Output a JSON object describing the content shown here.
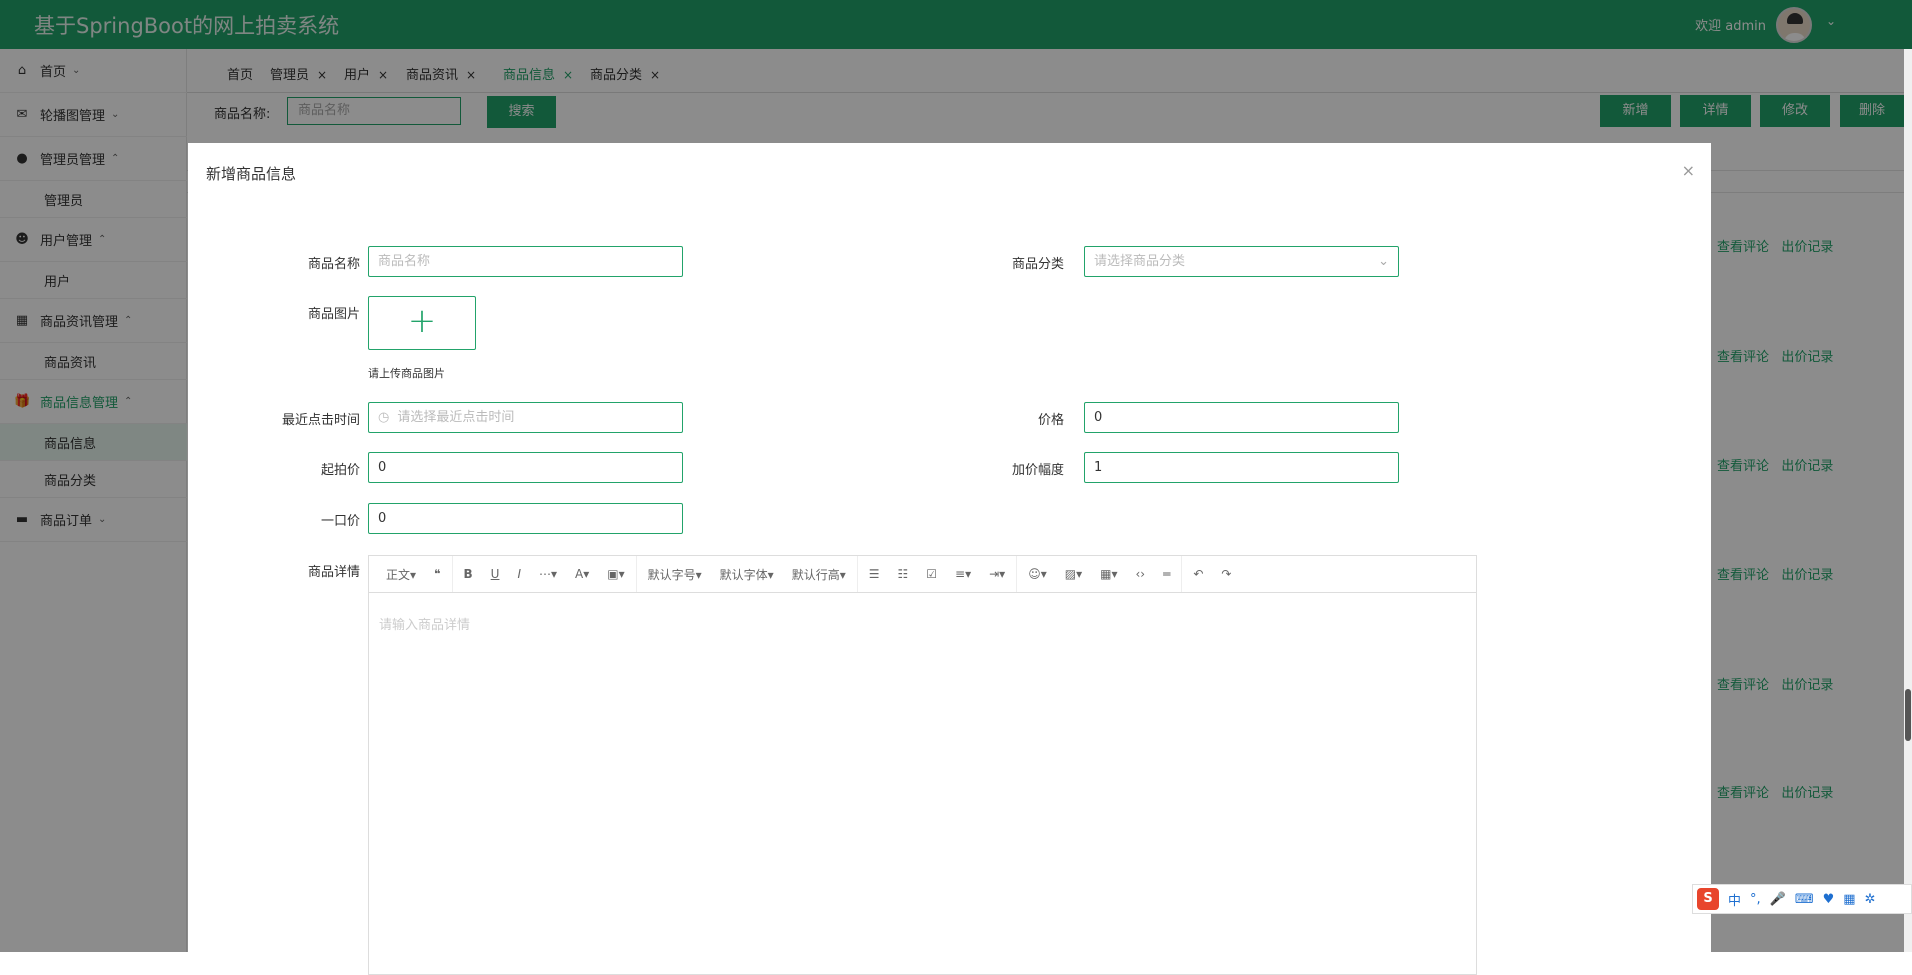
{
  "header": {
    "title": "基于SpringBoot的网上拍卖系统",
    "welcome": "欢迎 admin"
  },
  "sidebar": {
    "items": [
      {
        "label": "首页",
        "icon": "home-icon"
      },
      {
        "label": "轮播图管理",
        "icon": "mail-icon"
      },
      {
        "label": "管理员管理",
        "icon": "circle-icon"
      },
      {
        "label": "管理员"
      },
      {
        "label": "用户管理",
        "icon": "user-icon"
      },
      {
        "label": "用户"
      },
      {
        "label": "商品资讯管理",
        "icon": "building-icon"
      },
      {
        "label": "商品资讯"
      },
      {
        "label": "商品信息管理",
        "icon": "gift-icon"
      },
      {
        "label": "商品信息"
      },
      {
        "label": "商品分类"
      },
      {
        "label": "商品订单",
        "icon": "folder-icon"
      }
    ]
  },
  "tabs": [
    {
      "label": "首页"
    },
    {
      "label": "管理员"
    },
    {
      "label": "用户"
    },
    {
      "label": "商品资讯"
    },
    {
      "label": "商品信息"
    },
    {
      "label": "商品分类"
    }
  ],
  "tab_close": "×",
  "search": {
    "label": "商品名称:",
    "placeholder": "商品名称",
    "button": "搜索"
  },
  "actions": {
    "add": "新增",
    "detail": "详情",
    "edit": "修改",
    "delete": "删除"
  },
  "row_actions": {
    "comments": "查看评论",
    "bids": "出价记录"
  },
  "modal": {
    "title": "新增商品信息",
    "close": "×",
    "fields": {
      "name": {
        "label": "商品名称",
        "placeholder": "商品名称"
      },
      "category": {
        "label": "商品分类",
        "placeholder": "请选择商品分类"
      },
      "image": {
        "label": "商品图片",
        "hint": "请上传商品图片"
      },
      "click_time": {
        "label": "最近点击时间",
        "placeholder": "请选择最近点击时间"
      },
      "price": {
        "label": "价格",
        "value": "0"
      },
      "start_price": {
        "label": "起拍价",
        "value": "0"
      },
      "increment": {
        "label": "加价幅度",
        "value": "1"
      },
      "buy_now": {
        "label": "一口价",
        "value": "0"
      },
      "detail": {
        "label": "商品详情",
        "placeholder": "请输入商品详情"
      }
    },
    "editor_toolbar": [
      "正文▾",
      "❝",
      "B",
      "U",
      "I",
      "⋯▾",
      "A▾",
      "▣▾",
      "默认字号▾",
      "默认字体▾",
      "默认行高▾",
      "☰",
      "☷",
      "☑",
      "≡▾",
      "⇥▾",
      "☺▾",
      "▨▾",
      "▦▾",
      "‹›",
      "═",
      "↶",
      "↷"
    ]
  },
  "ime": {
    "lang": "中",
    "punct": "°,"
  }
}
